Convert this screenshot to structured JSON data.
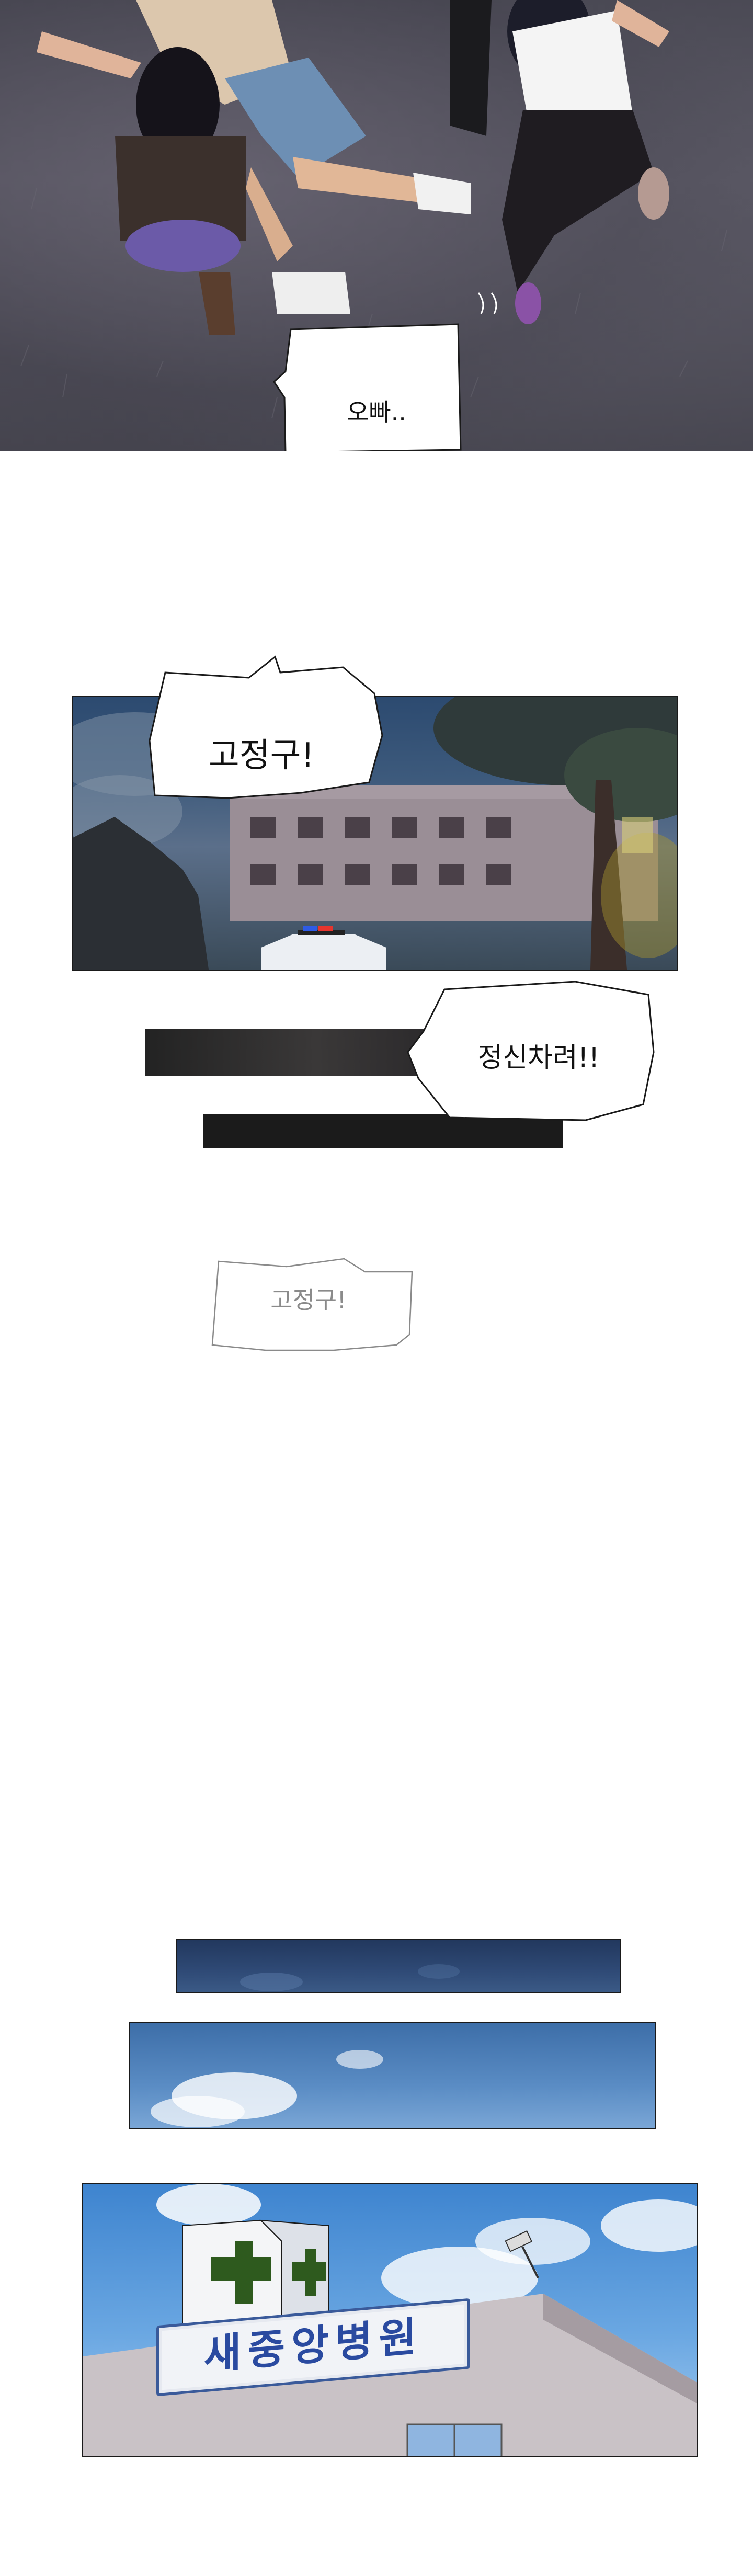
{
  "panels": {
    "panel1": {
      "speech": "오빠.."
    },
    "panel2": {
      "speech": "고정구!"
    },
    "interlude": {
      "speech_shout": "정신차려!!",
      "speech_faint": "고정구!"
    },
    "panel3": {
      "hospital_sign": "새중앙병원"
    }
  },
  "colors": {
    "night_sky": "#2c4a70",
    "day_sky": "#5a8cc4",
    "bubble_fill": "#ffffff",
    "bubble_outline": "#1a1a1a",
    "faint_bubble_outline": "#8a8a8a",
    "cross_green": "#2e5a1e",
    "sign_text": "#2a4aa0"
  },
  "icons": [
    "green-cross-icon",
    "police-light-icon",
    "security-camera-icon"
  ]
}
